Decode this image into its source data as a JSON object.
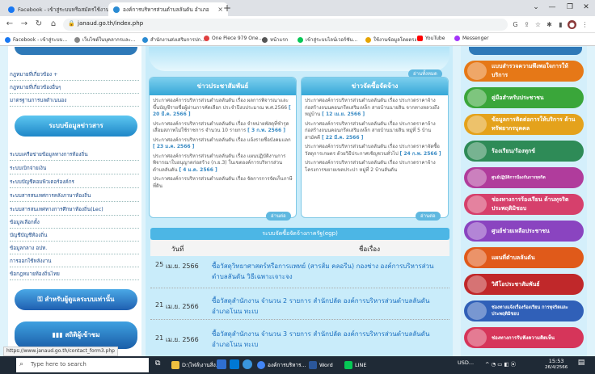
{
  "browser": {
    "tabs": [
      {
        "label": "Facebook - เข้าสู่ระบบหรือสมัครใช้งาน",
        "color": "#1877f2"
      },
      {
        "label": "องค์การบริหารส่วนตำบลลันดัน อำเภอ",
        "color": "#2a8bd3"
      }
    ],
    "url": "janaud.go.th/index.php",
    "bookmarks": [
      {
        "label": "Facebook - เข้าสู่ระบบ...",
        "color": "#1877f2"
      },
      {
        "label": "เว็บไซต์ในบุคลากรและ...",
        "color": "#888888"
      },
      {
        "label": "สำนักงานส่งเสริมการปก...",
        "color": "#2a8bd3"
      },
      {
        "label": "One Piece 979 One...",
        "color": "#e04040"
      },
      {
        "label": "หน้าแรก",
        "color": "#555555"
      },
      {
        "label": "เข้าสู่ระบบไลน์เวอร์ชัน...",
        "color": "#06c755"
      },
      {
        "label": "ใช้งานข้อมูลโดยตรง",
        "color": "#e6a400"
      },
      {
        "label": "YouTube",
        "color": "#ff0000"
      },
      {
        "label": "Messenger",
        "color": "#a334fa"
      }
    ]
  },
  "left_menu": {
    "links_top": [
      "กฎหมายที่เกี่ยวข้อง +",
      "กฎหมายที่เกี่ยวข้องอื่นๆ",
      "มาตรฐานการบลดำเนนอง"
    ],
    "banner1": "ระบบข้อมูลข่าวสาร",
    "links_mid": [
      "ระบบเครือข่ายข้อมูลทางการท้องถิ่น",
      "ระบบเบิกจ่ายเงิน",
      "ระบบบัญชีคอมพิวเตอร์องค์กร",
      "ระบบสารสนเทศการคลังภาษาท้องถิ่น",
      "ระบบสารสนเทศทางการศึกษาท้องถิ่น(Lec)",
      "ข้อมูลเลือกตั้ง",
      "บัญชีบัญชีท้องถิ่น",
      "ข้อมูลกลาง อปท.",
      "การออกใช้หลังงาน",
      "ข้อกฎหมายท้องถิ่นไทย"
    ],
    "banner2": "สำหรับผู้ดูแลระบบเท่านั้น",
    "banner3": "สถิติผู้เข้าชม"
  },
  "center": {
    "more_top": "อ่านทั้งหมด",
    "panel_left": {
      "title": "ข่าวประชาสัมพันธ์",
      "items": [
        {
          "text": "ประกาศองค์การบริหารส่วนตำบลลันดัน เรื่อง ผลการพิจารณาและขึ้นบัญชีรายชื่อผู้ผ่านการคัดเลือก ประจำปีงบประมาณ พ.ศ.2566",
          "date": "[ 20 มี.ค. 2566 ]"
        },
        {
          "text": "ประกาศองค์การบริหารส่วนตำบลลันดัน เรื่อง จำหน่ายพัสดุที่ชำรุดเสื่อมสภาพไม่ใช้ราชการ จำนวน 10 รายการ",
          "date": "[ 3 ก.พ. 2566 ]"
        },
        {
          "text": "ประกาศองค์การบริหารส่วนตำบลลันดัน เรื่อง แจ้งรายชื่อบังคมแลก",
          "date": "[ 23 ม.ค. 2566 ]"
        },
        {
          "text": "ประกาศองค์การบริหารส่วนตำบลลันดัน เรื่อง แผนปฏิบัติงานการพิจารณาใบอนุญาตก่อสร้าง (ก.ย.3) ในเขตองค์การบริหารส่วนตำบลลันดัน",
          "date": "[ 4 ม.ค. 2566 ]"
        },
        {
          "text": "ประกาศองค์การบริหารส่วนตำบลลันดัน เรื่อง จัดการการจัดเก็บภาษีที่ดิน",
          "date": ""
        }
      ],
      "more": "อ่านต่อ"
    },
    "panel_right": {
      "title": "ข่าวจัดซื้อจัดจ้าง",
      "items": [
        {
          "text": "ประกาศองค์การบริหารส่วนตำบลลันดัน เรื่อง ประกวดราคาจ้างก่อสร้างถนนคอนกรีตเสริมเหล็ก สายบ้านนายสิน จากทางหลวงถึงหมู่บ้าน",
          "date": "[ 12 เม.ย. 2566 ]"
        },
        {
          "text": "ประกาศองค์การบริหารส่วนตำบลลันดัน เรื่อง ประกวดราคาจ้างก่อสร้างถนนคอนกรีตเสริมเหล็ก สายบ้านนายสิน หมู่ที่ 5 บ้านสามัคคี",
          "date": "[ 22 มี.ค. 2566 ]"
        },
        {
          "text": "ประกาศองค์การบริหารส่วนตำบลลันดัน เรื่อง ประกวดราคาจัดซื้อวัสดุการเกษตร ด้วยวิธีประกาศเชิญชวนทั่วไป",
          "date": "[ 24 ก.พ. 2566 ]"
        },
        {
          "text": "ประกาศองค์การบริหารส่วนตำบลลันดัน เรื่อง ประกวดราคาจ้างโครงการขยายเขตประปา หมู่ที่ 2 บ้านลันดัน",
          "date": ""
        }
      ],
      "more": "อ่านต่อ"
    },
    "egp_title": "ระบบจัดซื้อจัดจ้างภาครัฐ(egp)",
    "table": {
      "columns": [
        "วันที่",
        "ชื่อเรื่อง"
      ],
      "rows": [
        {
          "num": "25",
          "date": "เม.ย. 2566",
          "title": "ซื้อวัสดุวิทยาศาสตร์หรือการแพทย์ (สารส้ม คลอรีน) กองช่าง องค์การบริหารส่วนตำบลลันดัน วิธีเฉพาะเจาะจง"
        },
        {
          "num": "21",
          "date": "เม.ย. 2566",
          "title": "ซื้อวัสดุสำนักงาน จำนวน 2 รายการ สำนักปลัด องค์การบริหารส่วนตำบลลันดัน อำเภอโนน ทะเบ"
        },
        {
          "num": "21",
          "date": "เม.ย. 2566",
          "title": "ซื้อวัสดุสำนักงาน จำนวน 3 รายการ สำนักปลัด องค์การบริหารส่วนตำบลลันดัน อำเภอโนน ทะเบ"
        }
      ]
    }
  },
  "right_menu": [
    {
      "label": "แบบสำรวจความพึงพอใจการให้บริการ",
      "color": "#e67817"
    },
    {
      "label": "คู่มือสำหรับประชาชน",
      "color": "#3aa63a"
    },
    {
      "label": "ข้อมูลการติดต่อการให้บริการ ด้านทรัพยากรบุคคล",
      "color": "#e4a21c"
    },
    {
      "label": "ร้องเรียน/ร้องทุกข์",
      "color": "#2e8b57"
    },
    {
      "label": "ศูนย์ปฏิบัติการป้องกันการทุจริต",
      "color": "#b03c9c"
    },
    {
      "label": "ช่องทางการร้องเรียน ด้านทุจริตประพฤติมิชอบ",
      "color": "#d6406c"
    },
    {
      "label": "ศูนย์ช่วยเหลือประชาชน",
      "color": "#8a44c0"
    },
    {
      "label": "แผนที่ตำบลลันดัน",
      "color": "#e05a1a"
    },
    {
      "label": "วิดีโอประชาสัมพันธ์",
      "color": "#c0282a"
    },
    {
      "label": "ช่องทางแจ้งเรื่องร้องเรียน การทุจริตและประพฤติมิชอบ",
      "color": "#3060b8"
    },
    {
      "label": "ช่องทางการรับฟังความคิดเห็น",
      "color": "#d6355a"
    }
  ],
  "status_url": "https://www.janaud.go.th/contact_form3.php",
  "taskbar": {
    "search_placeholder": "Type here to search",
    "apps": [
      {
        "label": "D:\\ไฟล์\\งานสิ่ง...",
        "color": "#f0c040"
      },
      {
        "label": "องค์การบริหาร...",
        "color": "#4285f4"
      },
      {
        "label": "Word",
        "color": "#2b579a"
      },
      {
        "label": "LINE",
        "color": "#06c755"
      }
    ],
    "tray": "USD...",
    "clock_time": "15:53",
    "clock_date": "26/4/2566"
  }
}
